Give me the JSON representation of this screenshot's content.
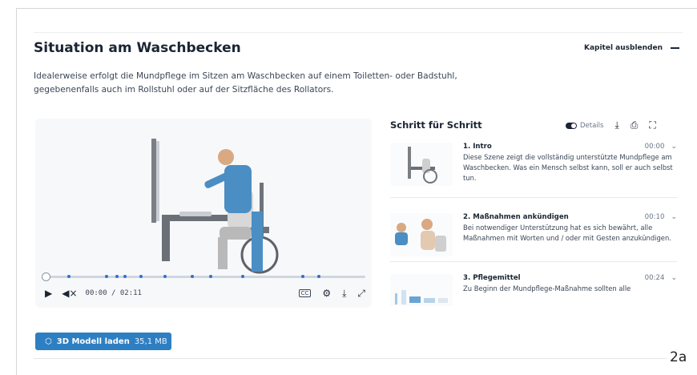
{
  "section": {
    "title": "Situation am Waschbecken",
    "hide_label": "Kapitel ausblenden",
    "intro": "Idealerweise erfolgt die Mundpflege im Sitzen am Waschbecken auf einem Toiletten- oder Badstuhl, gegebenenfalls auch im Rollstuhl oder auf der Sitzfläche des Rollators."
  },
  "player": {
    "time": "00:00 / 02:11",
    "progress": 0.0
  },
  "steps_panel": {
    "title": "Schritt für Schritt",
    "details_label": "Details",
    "steps": [
      {
        "name": "1. Intro",
        "time": "00:00",
        "desc": "Diese Szene zeigt die vollständig unterstützte Mundpflege am Waschbecken. Was ein Mensch selbst kann, soll er auch selbst tun."
      },
      {
        "name": "2. Maßnahmen ankündigen",
        "time": "00:10",
        "desc": "Bei notwendiger Unterstützung hat es sich bewährt, alle Maßnahmen mit Worten und / oder mit Gesten anzukündigen."
      },
      {
        "name": "3. Pflegemittel",
        "time": "00:24",
        "desc": "Zu Beginn der Mundpflege-Maßnahme sollten alle"
      }
    ]
  },
  "load_button": {
    "label": "3D Modell laden",
    "size": "35,1 MB"
  },
  "figure_label": "2a",
  "colors": {
    "accent": "#2e7fc2",
    "chapter_marker": "#2e6fd6",
    "text": "#1b2533"
  },
  "icons": [
    "play-icon",
    "mute-icon",
    "captions-icon",
    "settings-icon",
    "download-icon",
    "fullscreen-icon",
    "print-icon",
    "expand-icon",
    "chevron-down-icon",
    "cube-icon"
  ]
}
